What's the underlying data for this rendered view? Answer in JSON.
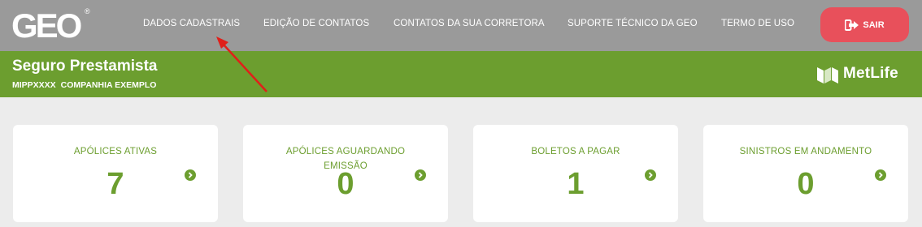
{
  "header": {
    "logo_text": "GEO",
    "logo_mark": "®",
    "nav": [
      {
        "label": "DADOS CADASTRAIS"
      },
      {
        "label": "EDIÇÃO DE CONTATOS"
      },
      {
        "label": "CONTATOS DA SUA CORRETORA"
      },
      {
        "label": "SUPORTE TÉCNICO DA GEO"
      },
      {
        "label": "TERMO DE USO"
      }
    ],
    "logout": {
      "label": "SAIR",
      "icon": "logout-icon"
    }
  },
  "product": {
    "title": "Seguro Prestamista",
    "policy_code": "MIPPXXXX",
    "company": "COMPANHIA EXEMPLO",
    "partner_logo": "MetLife"
  },
  "cards": [
    {
      "title_line1": "APÓLICES ATIVAS",
      "title_line2": "",
      "value": "7"
    },
    {
      "title_line1": "APÓLICES AGUARDANDO",
      "title_line2": "EMISSÃO",
      "value": "0"
    },
    {
      "title_line1": "BOLETOS A PAGAR",
      "title_line2": "",
      "value": "1"
    },
    {
      "title_line1": "SINISTROS EM ANDAMENTO",
      "title_line2": "",
      "value": "0"
    }
  ],
  "colors": {
    "topbar": "#9a9a9a",
    "brand_green": "#6c9e2f",
    "logout_red": "#e8505b",
    "annotation_red": "#e0201a",
    "background": "#ececec"
  }
}
